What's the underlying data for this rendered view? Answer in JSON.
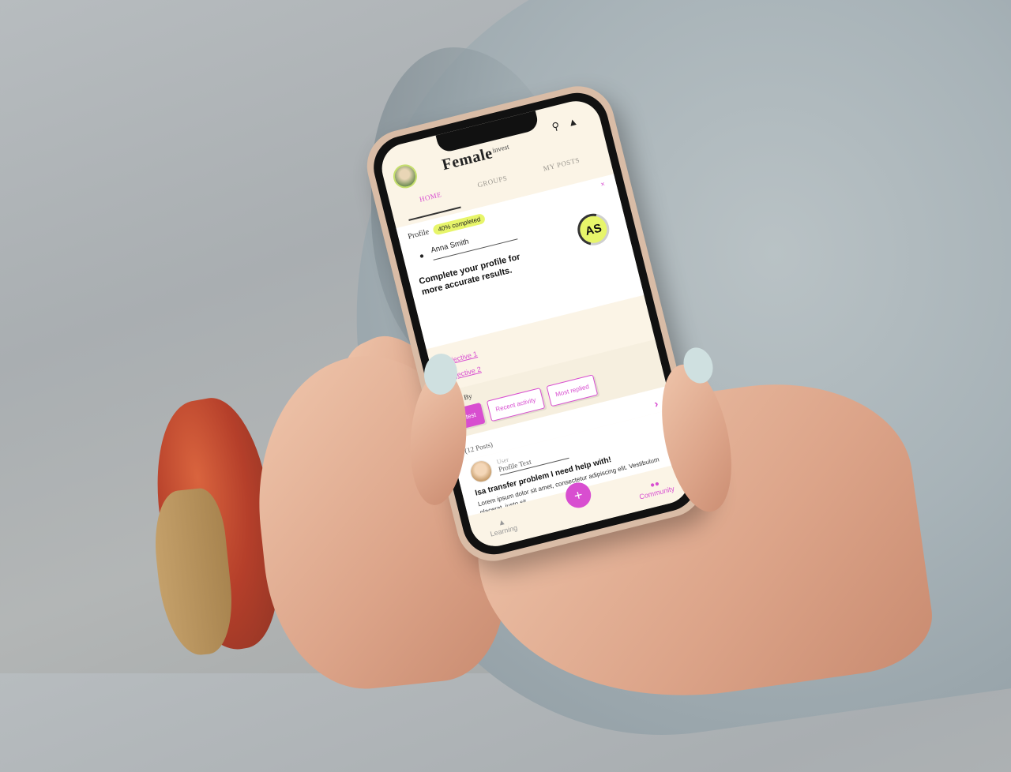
{
  "header": {
    "brand_main": "Female",
    "brand_sub": "invest"
  },
  "tabs": [
    {
      "label": "HOME",
      "active": true
    },
    {
      "label": "GROUPS",
      "active": false
    },
    {
      "label": "MY POSTS",
      "active": false
    }
  ],
  "profile_card": {
    "label": "Profile",
    "progress_text": "40% completed",
    "progress_value": 0.4,
    "name": "Anna Smith",
    "initials": "AS",
    "message": "Complete your profile for more accurate results.",
    "close": "×"
  },
  "objectives": [
    "Objective 1",
    "Objective 2"
  ],
  "sort": {
    "label": "Sort By",
    "options": [
      {
        "label": "Latest",
        "active": true
      },
      {
        "label": "Recent activity",
        "active": false
      },
      {
        "label": "Most replied",
        "active": false
      }
    ]
  },
  "posts": {
    "count_text": "(12 Posts)",
    "items": [
      {
        "user_label": "User",
        "profile_text": "Profile Text",
        "title": "Isa transfer problem I need help with!",
        "body": "Lorem ipsum dolor sit amet, consectetur adipiscing elit. Vestibulum placerat, justo sit"
      }
    ]
  },
  "bottom_nav": {
    "learning": "Learning",
    "community": "Community",
    "fab": "+"
  },
  "colors": {
    "accent": "#d84ed0",
    "highlight": "#e7f56a",
    "screen_bg": "#fbf4e6"
  },
  "icons": {
    "search": "search-icon",
    "bell": "bell-icon",
    "user": "user-icon",
    "chevron": "chevron-right-icon",
    "learning": "graduation-cap-icon",
    "community": "people-icon"
  }
}
